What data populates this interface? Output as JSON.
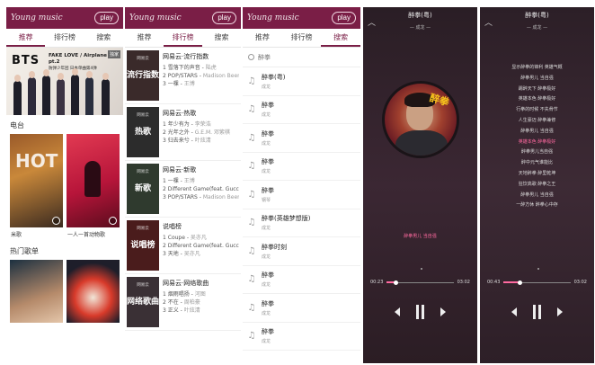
{
  "app": {
    "logo": "Young music",
    "play_label": "play"
  },
  "tabs": [
    "推荐",
    "排行榜",
    "搜索"
  ],
  "home": {
    "banner_title": "BTS",
    "banner_subtitle": "FAKE LOVE / Airplane pt.2",
    "banner_sub2": "防弹少年团 日本单曲第4弹",
    "banner_badge": "独家",
    "section1": "电台",
    "cards": [
      {
        "caption": "米歌"
      },
      {
        "caption": "一人一首动物歌"
      }
    ],
    "section2": "热门歌单"
  },
  "ranks": [
    {
      "title": "网易云·流行指数",
      "cover_text": "流行指数",
      "items": [
        {
          "n": "1",
          "song": "雪落下的声音",
          "artist": "陆虎"
        },
        {
          "n": "2",
          "song": "POP/STARS",
          "artist": "Madison Beer"
        },
        {
          "n": "3",
          "song": "一棵",
          "artist": "王博"
        }
      ]
    },
    {
      "title": "网易云·热歌",
      "cover_text": "热歌",
      "items": [
        {
          "n": "1",
          "song": "年少有为",
          "artist": "李荣浩"
        },
        {
          "n": "2",
          "song": "光年之外",
          "artist": "G.E.M. 邓紫棋"
        },
        {
          "n": "3",
          "song": "归去来兮",
          "artist": "叶炫清"
        }
      ]
    },
    {
      "title": "网易云·新歌",
      "cover_text": "新歌",
      "items": [
        {
          "n": "1",
          "song": "一棵",
          "artist": "王博"
        },
        {
          "n": "2",
          "song": "Different Game(feat. Gucci M...",
          "artist": ""
        },
        {
          "n": "3",
          "song": "POP/STARS",
          "artist": "Madison Beer"
        }
      ]
    },
    {
      "title": "说唱榜",
      "cover_text": "说唱榜",
      "items": [
        {
          "n": "1",
          "song": "Coupe",
          "artist": "吴亦凡"
        },
        {
          "n": "2",
          "song": "Different Game(feat. Gucci M...",
          "artist": ""
        },
        {
          "n": "3",
          "song": "天地",
          "artist": "吴亦凡"
        }
      ]
    },
    {
      "title": "网易云·网络歌曲",
      "cover_text": "网络歌曲",
      "items": [
        {
          "n": "1",
          "song": "烟雨唱扬",
          "artist": "河图"
        },
        {
          "n": "2",
          "song": "不在",
          "artist": "周柏豪"
        },
        {
          "n": "3",
          "song": "正义",
          "artist": "叶炫清"
        }
      ]
    }
  ],
  "search": {
    "placeholder": "醉拳",
    "results": [
      {
        "name": "醉拳(粤)",
        "artist": "成龙"
      },
      {
        "name": "醉拳",
        "artist": "成龙"
      },
      {
        "name": "醉拳",
        "artist": "成龙"
      },
      {
        "name": "醉拳",
        "artist": "成龙"
      },
      {
        "name": "醉拳",
        "artist": "钢琴"
      },
      {
        "name": "醉拳(英雄梦想版)",
        "artist": "成龙"
      },
      {
        "name": "醉拳时刻",
        "artist": "成龙"
      },
      {
        "name": "醉拳",
        "artist": "成龙"
      },
      {
        "name": "醉拳",
        "artist": "成龙"
      },
      {
        "name": "醉拳",
        "artist": "成龙"
      }
    ]
  },
  "player1": {
    "title": "醉拳(粤)",
    "artist": "— 成龙 —",
    "lyric_line": "醉拳男儿 当自强",
    "time_current": "00:23",
    "time_total": "03:02",
    "progress": 0.13
  },
  "player2": {
    "title": "醉拳(粤)",
    "artist": "— 成龙 —",
    "time_current": "00:43",
    "time_total": "03:02",
    "progress": 0.24,
    "lyrics": [
      "显示醉拳的锋利 英雄气概",
      "醉拳男儿 当自强",
      "踢醉天下 醉拳极好",
      "英雄本色 醉拳极好",
      "行拳的时候 不失骨节",
      "人生豪迈 醉拳兼修",
      "醉拳男儿 当自强",
      "英雄本色 醉拳极好",
      "醉拳男儿当自强",
      "醉中元气谁能比",
      "天地醉拳 醉里乾坤",
      "狂饮高歌 醉拳之王",
      "醉拳男儿 当自强",
      "一醉方休 醉拳心中存"
    ]
  },
  "colors": {
    "brand": "#7a1e46",
    "highlight": "#ff6aa0"
  }
}
